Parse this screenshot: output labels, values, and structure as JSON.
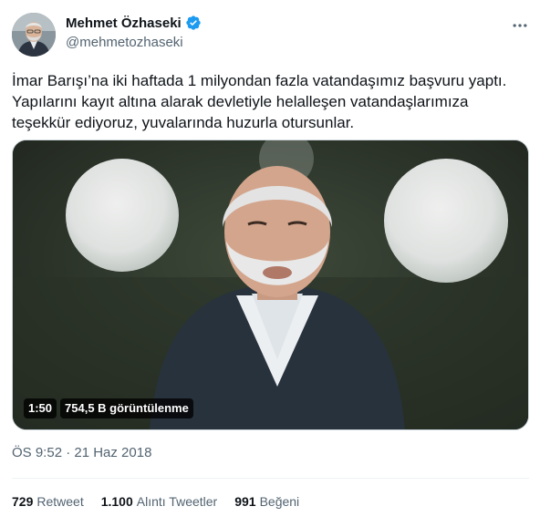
{
  "author": {
    "display_name": "Mehmet Özhaseki",
    "handle": "@mehmetozhaseki",
    "verified": true,
    "avatar_icon": "profile-photo"
  },
  "tweet": {
    "text": "İmar Barışı’na iki haftada 1 milyondan fazla vatandaşımız başvuru yaptı.\nYapılarını kayıt altına alarak devletiyle helalleşen vatandaşlarımıza\nteşekkür ediyoruz, yuvalarında huzurla otursunlar."
  },
  "video": {
    "duration": "1:50",
    "views": "754,5 B görüntülenme"
  },
  "meta": {
    "timestamp": "ÖS 9:52 · 21 Haz 2018"
  },
  "stats": {
    "retweets_count": "729",
    "retweets_label": "Retweet",
    "quotes_count": "1.100",
    "quotes_label": "Alıntı Tweetler",
    "likes_count": "991",
    "likes_label": "Beğeni"
  },
  "colors": {
    "verified": "#1d9bf0",
    "secondary_text": "#536471",
    "primary_text": "#0f1419",
    "divider": "#eff3f4"
  }
}
